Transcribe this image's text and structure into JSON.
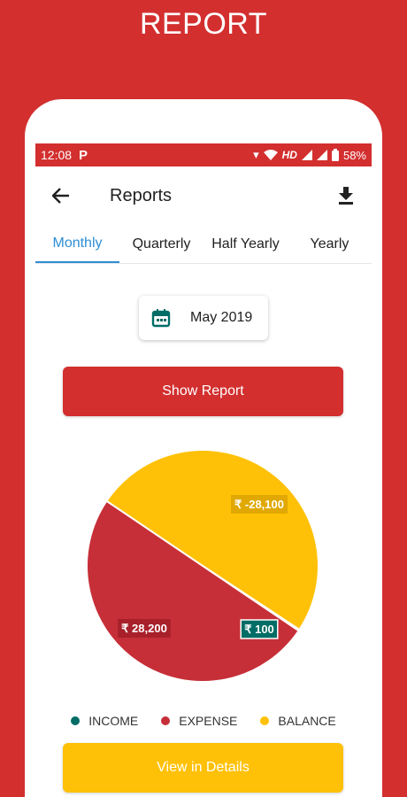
{
  "promo": {
    "title": "REPORT"
  },
  "status": {
    "time": "12:08",
    "p_icon": "P",
    "network": "HD",
    "battery": "58%"
  },
  "appbar": {
    "title": "Reports"
  },
  "tabs": [
    {
      "label": "Monthly",
      "active": true
    },
    {
      "label": "Quarterly",
      "active": false
    },
    {
      "label": "Half Yearly",
      "active": false
    },
    {
      "label": "Yearly",
      "active": false
    }
  ],
  "date": {
    "label": "May 2019"
  },
  "buttons": {
    "show_report": "Show Report",
    "view_details": "View in Details"
  },
  "colors": {
    "brand_red": "#d32f2f",
    "expense": "#c62f38",
    "balance": "#ffc107",
    "income": "#006d66",
    "tab_active": "#2c8ed6"
  },
  "chart_data": {
    "type": "pie",
    "slices": [
      {
        "name": "INCOME",
        "value": 100,
        "label": "₹ 100"
      },
      {
        "name": "EXPENSE",
        "value": 28200,
        "label": "₹ 28,200"
      },
      {
        "name": "BALANCE",
        "value": -28100,
        "label": "₹ -28,100"
      }
    ],
    "legend": [
      "INCOME",
      "EXPENSE",
      "BALANCE"
    ],
    "legend_position": "bottom"
  }
}
